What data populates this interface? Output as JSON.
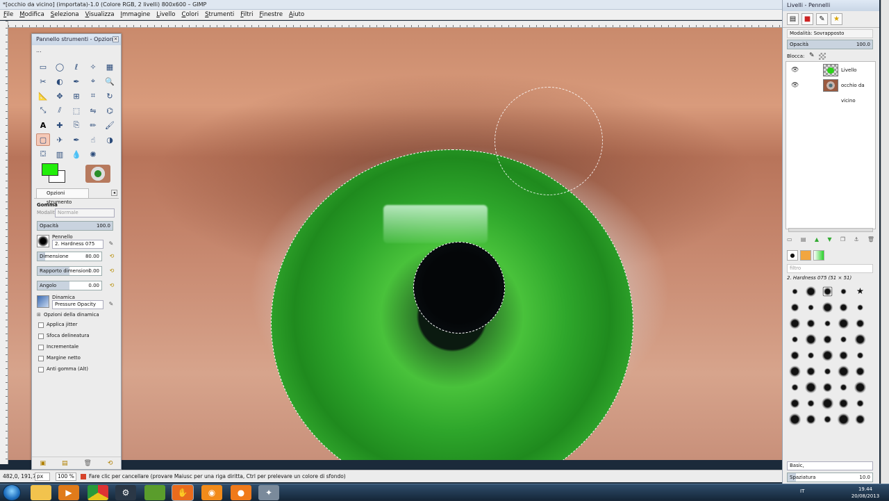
{
  "window": {
    "title": "*[occhio da vicino] (importata)-1.0 (Colore RGB, 2 livelli) 800x600 – GIMP"
  },
  "menu": [
    "File",
    "Modifica",
    "Seleziona",
    "Visualizza",
    "Immagine",
    "Livello",
    "Colori",
    "Strumenti",
    "Filtri",
    "Finestre",
    "Aiuto"
  ],
  "toolbox": {
    "title": "Pannello strumenti - Opzioni ...",
    "tools": [
      "rect-select",
      "ellipse-select",
      "free-select",
      "fuzzy-select",
      "color-select",
      "scissors",
      "foreground-select",
      "paths",
      "color-picker",
      "zoom",
      "measure",
      "move",
      "align",
      "crop",
      "rotate",
      "scale",
      "shear",
      "perspective",
      "flip",
      "cage",
      "text",
      "heal",
      "clone",
      "pencil",
      "paintbrush",
      "eraser",
      "airbrush",
      "ink",
      "smudge",
      "dodge-burn",
      "bucket-fill",
      "blend",
      "blur",
      "convolve"
    ],
    "active_tool": "eraser",
    "fg_color": "#22ee0a",
    "bg_color": "#ffffff",
    "options_tab": "Opzioni strumento",
    "tool_name": "Gomma",
    "mode_label": "Modalità",
    "mode_value": "Normale",
    "opacity": {
      "label": "Opacità",
      "value": "100.0",
      "fraction": 1.0
    },
    "brush_label": "Pennello",
    "brush_value": "2. Hardness 075",
    "size": {
      "label": "Dimensione",
      "value": "80.00",
      "fraction": 0.12
    },
    "aspect": {
      "label": "Rapporto dimensioni",
      "value": "0.00",
      "fraction": 0.5
    },
    "angle": {
      "label": "Angolo",
      "value": "0.00",
      "fraction": 0.5
    },
    "dynamics_label": "Dinamica",
    "dynamics_value": "Pressure Opacity",
    "dynamics_options": "Opzioni della dinamica",
    "checks": [
      "Applica jitter",
      "Sfoca delineatura",
      "Incrementale",
      "Margine netto",
      "Anti gomma  (Alt)"
    ]
  },
  "layers_dock": {
    "title": "Livelli - Pennelli",
    "mode_label": "Modalità: Sovrapposto",
    "opacity_label": "Opacità",
    "opacity_value": "100.0",
    "lock_label": "Blocca:",
    "layers": [
      {
        "name": "Livello"
      },
      {
        "name": "occhio da vicino"
      }
    ],
    "brush_filter_placeholder": "filtro",
    "brush_selected": "2. Hardness 075 (51 × 51)",
    "brush_set": "Basic,",
    "spacing_label": "Spaziatura",
    "spacing_value": "10.0"
  },
  "status": {
    "coords": "482,0, 191,7",
    "unit": "px",
    "zoom": "100 %",
    "message": "Fare clic per cancellare (provare Maiusc per una riga diritta, Ctrl per prelevare un colore di sfondo)"
  },
  "taskbar": {
    "apps": [
      "explorer",
      "media",
      "chrome",
      "steam",
      "minecraft",
      "gimp",
      "blender",
      "origin",
      "wilbur"
    ],
    "lang": "IT",
    "time": "19.44",
    "date": "20/08/2013"
  }
}
